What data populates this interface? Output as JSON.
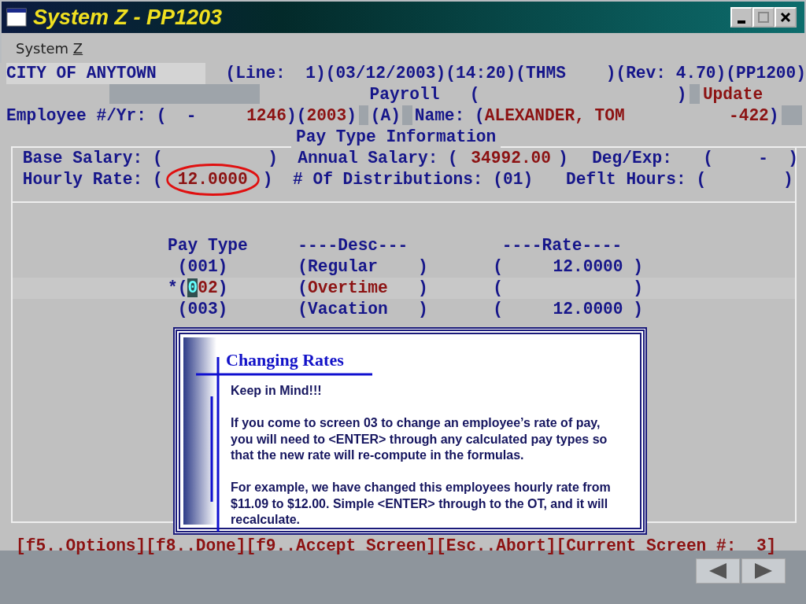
{
  "window": {
    "title": "System Z - PP1203",
    "menu": [
      {
        "label": "System ",
        "accelerator": "Z"
      }
    ]
  },
  "header_lines": [
    [
      {
        "kind": "field",
        "text": "CITY OF ANYTOWN"
      },
      {
        "kind": "label",
        "text": "(Line:  1)(03/12/2003)(14:20)(THMS    )(Rev: 4.70)(PP1200)"
      }
    ],
    [
      {
        "kind": "blank"
      },
      {
        "kind": "label",
        "text": "Payroll   ("
      },
      {
        "kind": "label",
        "text": ")"
      },
      {
        "kind": "blank"
      },
      {
        "kind": "value",
        "text": "Update"
      }
    ],
    [
      {
        "kind": "label",
        "text": "Employee #/Yr: (  -"
      },
      {
        "kind": "value",
        "text": "1246"
      },
      {
        "kind": "label",
        "text": ")("
      },
      {
        "kind": "value",
        "text": "2003"
      },
      {
        "kind": "label",
        "text": ")"
      },
      {
        "kind": "blank"
      },
      {
        "kind": "label",
        "text": "(A)"
      },
      {
        "kind": "blank"
      },
      {
        "kind": "label",
        "text": "Name: ("
      },
      {
        "kind": "value",
        "text": "ALEXANDER, TOM"
      },
      {
        "kind": "value",
        "text": "-422"
      },
      {
        "kind": "label",
        "text": ")"
      },
      {
        "kind": "blank"
      }
    ]
  ],
  "pay_info": {
    "title": "Pay Type Information",
    "lines": [
      [
        {
          "kind": "label",
          "text": "Base Salary: ("
        },
        {
          "kind": "label",
          "text": ")"
        },
        {
          "kind": "label",
          "text": "Annual Salary: ("
        },
        {
          "kind": "value",
          "text": "34992.00"
        },
        {
          "kind": "label",
          "text": ")"
        },
        {
          "kind": "label",
          "text": "Deg/Exp:"
        },
        {
          "kind": "label",
          "text": "("
        },
        {
          "kind": "label",
          "text": "-"
        },
        {
          "kind": "label",
          "text": ")"
        }
      ],
      [
        {
          "kind": "label",
          "text": "Hourly Rate: ("
        },
        {
          "kind": "value",
          "text": "12.0000",
          "circled": true
        },
        {
          "kind": "label",
          "text": ")"
        },
        {
          "kind": "label",
          "text": "# Of Distributions: (01)"
        },
        {
          "kind": "label",
          "text": "Deflt Hours: ("
        },
        {
          "kind": "label",
          "text": ")"
        }
      ]
    ]
  },
  "pay_types": {
    "columns": [
      "Pay Type",
      "----Desc---",
      "----Rate----"
    ],
    "rows": [
      {
        "selected": false,
        "code": "(001)",
        "desc": "(Regular    )",
        "rate": "(     12.0000 )"
      },
      {
        "selected": true,
        "marker": "*",
        "code": "(002)",
        "desc": "(Overtime   )",
        "rate": "(             )"
      },
      {
        "selected": false,
        "code": "(003)",
        "desc": "(Vacation   )",
        "rate": "(     12.0000 )"
      }
    ]
  },
  "status_bar": "[f5..Options][f8..Done][f9..Accept Screen][Esc..Abort][Current Screen #:  3]",
  "callout": {
    "title": "Changing Rates",
    "paragraphs": [
      "Keep in Mind!!!",
      "If you come to screen 03 to change an employee’s rate of pay, you will need to <ENTER> through any calculated pay types so that the new rate will re-compute in the formulas.",
      "For example, we have changed this employees hourly rate from $11.09 to $12.00.  Simple <ENTER> through to the OT, and it will recalculate."
    ]
  }
}
